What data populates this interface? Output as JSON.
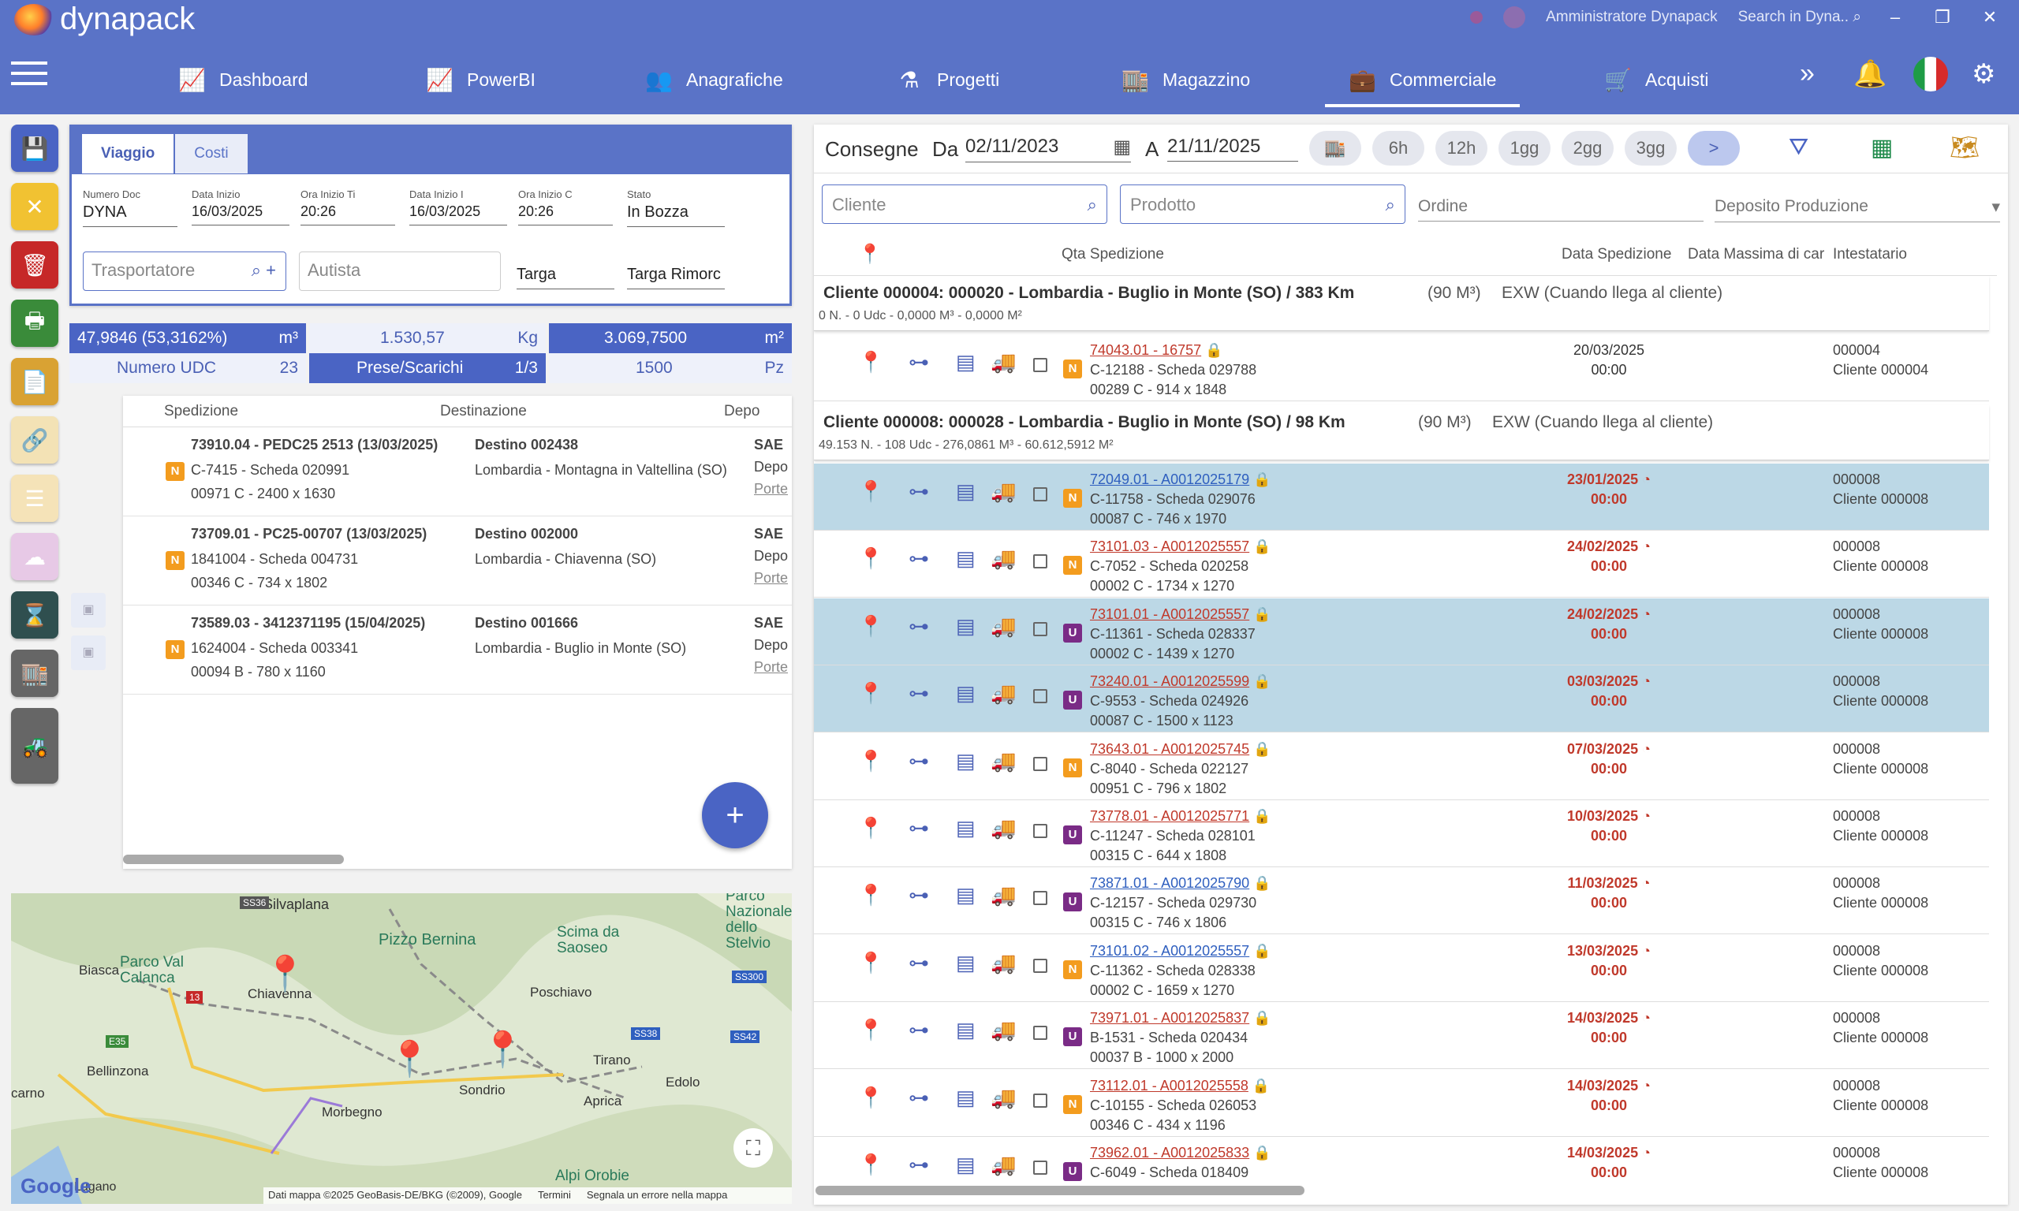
{
  "app": {
    "name": "dynapack",
    "user": "Amministratore Dynapack",
    "search_placeholder": "Search in Dyna..",
    "min": "–",
    "restore": "❐",
    "close": "✕"
  },
  "nav": {
    "items": [
      {
        "label": "Dashboard",
        "icon": "chart-icon"
      },
      {
        "label": "PowerBI",
        "icon": "chart-icon"
      },
      {
        "label": "Anagrafiche",
        "icon": "people-icon"
      },
      {
        "label": "Progetti",
        "icon": "flask-icon"
      },
      {
        "label": "Magazzino",
        "icon": "warehouse-icon"
      },
      {
        "label": "Commerciale",
        "icon": "briefcase-icon",
        "active": true
      },
      {
        "label": "Acquisti",
        "icon": "cart-icon"
      }
    ]
  },
  "left": {
    "tabs": [
      "Viaggio",
      "Costi"
    ],
    "fields": {
      "numero_doc_label": "Numero Doc",
      "numero_doc": "DYNA",
      "data_inizio_t_label": "Data Inizio ",
      "data_inizio_t": "16/03/2025",
      "ora_inizio_t_label": "Ora Inizio Ti",
      "ora_inizio_t": "20:26",
      "data_inizio_c_label": "Data Inizio I",
      "data_inizio_c": "16/03/2025",
      "ora_inizio_c_label": "Ora Inizio C",
      "ora_inizio_c": "20:26",
      "stato_label": "Stato",
      "stato": "In Bozza",
      "trasportatore_ph": "Trasportatore",
      "autista_ph": "Autista",
      "targa_ph": "Targa",
      "targa_rimorchio_ph": "Targa Rimorc"
    },
    "stats": {
      "volume": "47,9846 (53,3162%)",
      "volume_unit": "m³",
      "weight": "1.530,57",
      "weight_unit": "Kg",
      "area": "3.069,7500",
      "area_unit": "m²",
      "udc_label": "Numero UDC",
      "udc": "23",
      "prese_label": "Prese/Scarichi",
      "prese": "1/3",
      "pz": "1500",
      "pz_unit": "Pz"
    },
    "grid_headers": [
      "Spedizione",
      "Destinazione",
      "Depo"
    ],
    "rows": [
      {
        "title": "73910.04 - PEDC25 2513 (13/03/2025)",
        "badge": "N",
        "line2": "C-7415 - Scheda 020991",
        "line3": "00971 C - 2400 x 1630",
        "dest_title": "Destino 002438",
        "dest": "Lombardia - Montagna in Valtellina (SO)",
        "depo1": "SAE",
        "depo2": "Depo",
        "depo3": "Porte"
      },
      {
        "title": "73709.01 - PC25-00707 (13/03/2025)",
        "badge": "N",
        "line2": "1841004 - Scheda 004731",
        "line3": "00346 C - 734 x 1802",
        "dest_title": "Destino 002000",
        "dest": "Lombardia - Chiavenna (SO)",
        "depo1": "SAE",
        "depo2": "Depo",
        "depo3": "Porte"
      },
      {
        "title": "73589.03 - 3412371195 (15/04/2025)",
        "badge": "N",
        "line2": "1624004 - Scheda 003341",
        "line3": "00094 B - 780 x 1160",
        "dest_title": "Destino 001666",
        "dest": "Lombardia - Buglio in Monte (SO)",
        "depo1": "SAE",
        "depo2": "Depo",
        "depo3": "Porte"
      }
    ],
    "fab": "+"
  },
  "map": {
    "labels": [
      "Silvaplana",
      "Pizzo Bernina",
      "Scima da Saoseo",
      "Parco Nazionale dello Stelvio",
      "Biasca",
      "Parco Val Calanca",
      "Chiavenna",
      "Poschiavo",
      "Tirano",
      "Bellinzona",
      "Edolo",
      "Sondrio",
      "Morbegno",
      "Aprica",
      "carno",
      "Alpi Orobie",
      "Lugano"
    ],
    "roads": [
      "SS36",
      "SS300",
      "SS38",
      "SS42",
      "E35",
      "13"
    ],
    "attribution": "Dati mappa ©2025 GeoBasis-DE/BKG (©2009), Google",
    "terms": "Termini",
    "report": "Segnala un errore nella mappa",
    "google": "Google"
  },
  "right": {
    "title": "Consegne",
    "da_label": "Da",
    "da": "02/11/2023",
    "a_label": "A",
    "a": "21/11/2025",
    "chips": [
      "6h",
      "12h",
      "1gg",
      "2gg",
      "3gg"
    ],
    "next": ">",
    "search": {
      "cliente": "Cliente",
      "prodotto": "Prodotto",
      "ordine": "Ordine",
      "deposito": "Deposito Produzione"
    },
    "headers": [
      "Qta Spedizione",
      "Data Spedizione",
      "Data Massima di car",
      "Intestatario"
    ],
    "group1": {
      "title": "Cliente 000004: 000020 - Lombardia - Buglio in Monte (SO) / 383 Km",
      "vol": "(90 M³)",
      "exw": "EXW (Cuando llega al cliente)",
      "sub": "0 N. - 0 Udc - 0,0000 M³ - 0,0000 M²"
    },
    "group2": {
      "title": "Cliente 000008: 000028 - Lombardia - Buglio in Monte (SO) / 98 Km",
      "vol": "(90 M³)",
      "exw": "EXW (Cuando llega al cliente)",
      "sub": "49.153 N. - 108 Udc - 276,0861 M³ - 60.612,5912 M²"
    },
    "rows": [
      {
        "link": "74043.01 - 16757",
        "lc": "red",
        "badge": "N",
        "l2": "C-12188 - Scheda 029788",
        "l3": "00289 C - 914 x 1848",
        "d1": "20/03/2025",
        "d2": "00:00",
        "red": false,
        "c1": "000004",
        "c2": "Cliente 000004",
        "sel": false
      },
      {
        "link": "72049.01 - A0012025179",
        "lc": "bl",
        "badge": "N",
        "l2": "C-11758 - Scheda 029076",
        "l3": "00087 C - 746 x 1970",
        "d1": "23/01/2025",
        "d2": "00:00",
        "red": true,
        "c1": "000008",
        "c2": "Cliente 000008",
        "sel": true
      },
      {
        "link": "73101.03 - A0012025557",
        "lc": "red",
        "badge": "N",
        "l2": "C-7052 - Scheda 020258",
        "l3": "00002 C - 1734 x 1270",
        "d1": "24/02/2025",
        "d2": "00:00",
        "red": true,
        "c1": "000008",
        "c2": "Cliente 000008",
        "sel": false
      },
      {
        "link": "73101.01 - A0012025557",
        "lc": "red",
        "badge": "U",
        "l2": "C-11361 - Scheda 028337",
        "l3": "00002 C - 1439 x 1270",
        "d1": "24/02/2025",
        "d2": "00:00",
        "red": true,
        "c1": "000008",
        "c2": "Cliente 000008",
        "sel": true
      },
      {
        "link": "73240.01 - A0012025599",
        "lc": "red",
        "badge": "U",
        "l2": "C-9553 - Scheda 024926",
        "l3": "00087 C - 1500 x 1123",
        "d1": "03/03/2025",
        "d2": "00:00",
        "red": true,
        "c1": "000008",
        "c2": "Cliente 000008",
        "sel": true
      },
      {
        "link": "73643.01 - A0012025745",
        "lc": "red",
        "badge": "N",
        "l2": "C-8040 - Scheda 022127",
        "l3": "00951 C - 796 x 1802",
        "d1": "07/03/2025",
        "d2": "00:00",
        "red": true,
        "c1": "000008",
        "c2": "Cliente 000008",
        "sel": false
      },
      {
        "link": "73778.01 - A0012025771",
        "lc": "red",
        "badge": "U",
        "l2": "C-11247 - Scheda 028101",
        "l3": "00315 C - 644 x 1808",
        "d1": "10/03/2025",
        "d2": "00:00",
        "red": true,
        "c1": "000008",
        "c2": "Cliente 000008",
        "sel": false
      },
      {
        "link": "73871.01 - A0012025790",
        "lc": "bl",
        "badge": "U",
        "l2": "C-12157 - Scheda 029730",
        "l3": "00315 C - 746 x 1806",
        "d1": "11/03/2025",
        "d2": "00:00",
        "red": true,
        "c1": "000008",
        "c2": "Cliente 000008",
        "sel": false
      },
      {
        "link": "73101.02 - A0012025557",
        "lc": "bl",
        "badge": "N",
        "l2": "C-11362 - Scheda 028338",
        "l3": "00002 C - 1659 x 1270",
        "d1": "13/03/2025",
        "d2": "00:00",
        "red": true,
        "c1": "000008",
        "c2": "Cliente 000008",
        "sel": false
      },
      {
        "link": "73971.01 - A0012025837",
        "lc": "red",
        "badge": "U",
        "l2": "B-1531 - Scheda 020434",
        "l3": "00037 B - 1000 x 2000",
        "d1": "14/03/2025",
        "d2": "00:00",
        "red": true,
        "c1": "000008",
        "c2": "Cliente 000008",
        "sel": false
      },
      {
        "link": "73112.01 - A0012025558",
        "lc": "red",
        "badge": "N",
        "l2": "C-10155 - Scheda 026053",
        "l3": "00346 C - 434 x 1196",
        "d1": "14/03/2025",
        "d2": "00:00",
        "red": true,
        "c1": "000008",
        "c2": "Cliente 000008",
        "sel": false
      },
      {
        "link": "73962.01 - A0012025833",
        "lc": "red",
        "badge": "U",
        "l2": "C-6049 - Scheda 018409",
        "l3": "",
        "d1": "14/03/2025",
        "d2": "00:00",
        "red": true,
        "c1": "000008",
        "c2": "Cliente 000008",
        "sel": false
      }
    ]
  },
  "colors": {
    "primary": "#5a73c7",
    "accent_blue": "#4a64c4",
    "selected_row": "#bcd8e6",
    "badge_n": "#f39c1e",
    "badge_u": "#7a2b86",
    "danger": "#c0392b"
  }
}
